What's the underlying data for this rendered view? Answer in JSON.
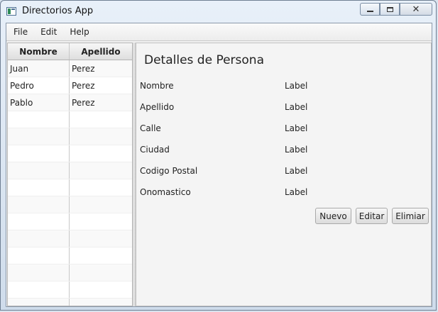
{
  "window": {
    "title": "Directorios App"
  },
  "menu": {
    "items": [
      "File",
      "Edit",
      "Help"
    ]
  },
  "table": {
    "headers": [
      "Nombre",
      "Apellido"
    ],
    "rows": [
      [
        "Juan",
        "Perez"
      ],
      [
        "Pedro",
        "Perez"
      ],
      [
        "Pablo",
        "Perez"
      ],
      [
        "",
        ""
      ],
      [
        "",
        ""
      ],
      [
        "",
        ""
      ],
      [
        "",
        ""
      ],
      [
        "",
        ""
      ],
      [
        "",
        ""
      ],
      [
        "",
        ""
      ],
      [
        "",
        ""
      ],
      [
        "",
        ""
      ],
      [
        "",
        ""
      ],
      [
        "",
        ""
      ],
      [
        "",
        ""
      ]
    ]
  },
  "details": {
    "title": "Detalles de Persona",
    "fields": [
      {
        "label": "Nombre",
        "value": "Label"
      },
      {
        "label": "Apellido",
        "value": "Label"
      },
      {
        "label": "Calle",
        "value": "Label"
      },
      {
        "label": "Ciudad",
        "value": "Label"
      },
      {
        "label": "Codigo Postal",
        "value": "Label"
      },
      {
        "label": "Onomastico",
        "value": "Label"
      }
    ],
    "buttons": {
      "nuevo": "Nuevo",
      "editar": "Editar",
      "eliminar": "Elimiar"
    }
  }
}
